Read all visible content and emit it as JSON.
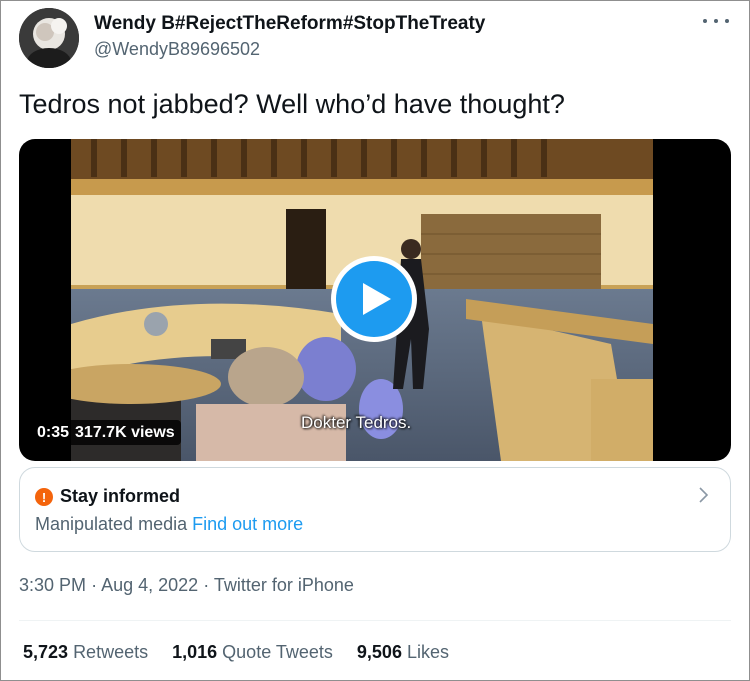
{
  "author": {
    "display_name": "Wendy B#RejectTheReform#StopTheTreaty",
    "handle": "@WendyB89696502",
    "avatar_icon": "profile-photo"
  },
  "tweet": {
    "text": "Tedros not jabbed? Well who’d have thought?",
    "more_icon": "more-horizontal-icon"
  },
  "media": {
    "duration": "0:35",
    "views": "317.7K views",
    "caption": "Dokter Tedros.",
    "play_icon": "play-icon"
  },
  "notice": {
    "icon": "warning-icon",
    "icon_glyph": "!",
    "title": "Stay informed",
    "subtitle": "Manipulated media",
    "link": "Find out more",
    "chevron_icon": "chevron-right-icon"
  },
  "meta": {
    "time": "3:30 PM",
    "date": "Aug 4, 2022",
    "source": "Twitter for iPhone",
    "separator": "·"
  },
  "stats": [
    {
      "count": "5,723",
      "label": "Retweets"
    },
    {
      "count": "1,016",
      "label": "Quote Tweets"
    },
    {
      "count": "9,506",
      "label": "Likes"
    }
  ],
  "colors": {
    "accent": "#1d9bf0",
    "warning": "#f4640c",
    "text_primary": "#0f1419",
    "text_secondary": "#536471"
  }
}
